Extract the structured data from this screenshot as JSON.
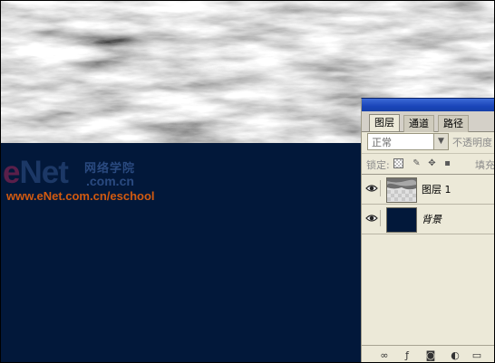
{
  "watermark": {
    "logo": "eNet",
    "logo_e": "e",
    "logo_rest": "Net",
    "chinese_text": "网络学院",
    "dotcom": ".com.cn",
    "url": "www.eNet.com.cn/eschool"
  },
  "layers_panel": {
    "tabs": [
      {
        "label": "图层",
        "active": true
      },
      {
        "label": "通道",
        "active": false
      },
      {
        "label": "路径",
        "active": false
      }
    ],
    "blend_mode": "正常",
    "opacity_label": "不透明度",
    "lock_label": "锁定:",
    "fill_label": "填充",
    "layers": [
      {
        "name": "图层 1",
        "visible": true,
        "thumbnail": "clouds"
      },
      {
        "name": "背景",
        "visible": true,
        "thumbnail": "dark-navy"
      }
    ]
  },
  "colors": {
    "canvas_background": "#02183a",
    "panel_background": "#ece9d8",
    "url_text": "#d25a10"
  }
}
